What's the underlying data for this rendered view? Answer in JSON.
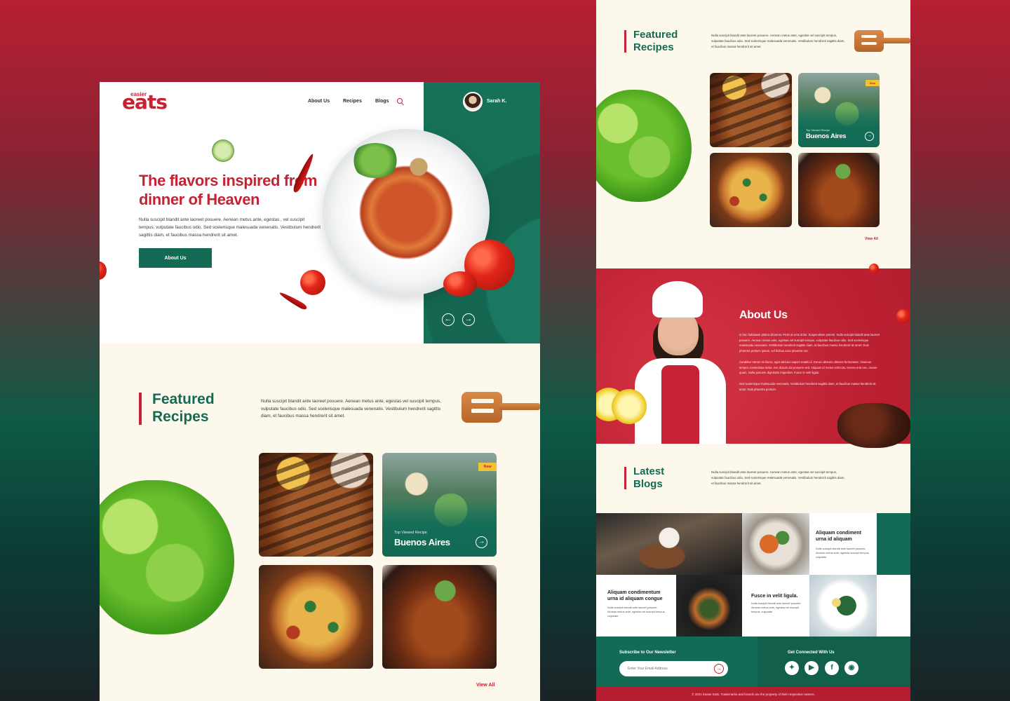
{
  "brand": {
    "logo_small": "easier",
    "logo_big": "eats"
  },
  "nav": {
    "about": "About Us",
    "recipes": "Recipes",
    "blogs": "Blogs"
  },
  "user": {
    "name": "Sarah K."
  },
  "hero": {
    "title": "The flavors inspired from dinner of Heaven",
    "text": "Nulla suscipit blandit ante laoreet posuere. Aenean metus ante, egestas , vel suscipit tempus, vulputate faucibus odio. Sed scelerisque malesuada venenatis. Vestibulum hendrerit sagittis diam, et faucibus massa hendrerit sit amet.",
    "button": "About Us"
  },
  "featured": {
    "title_line1": "Featured",
    "title_line2": "Recipes",
    "text": "Nulla suscipit blandit ante laoreet posuere. Aenean metus ante, egestas vel suscipit tempus, vulputate faucibus odio. Sed scelerisque malesuada venenatis. Vestibulum hendrerit sagittis diam, et faucibus massa hendrerit sit amet.",
    "badge": "New",
    "card_small": "Top Viewed Recipe",
    "card_big": "Buenos Aires",
    "view_all": "View All"
  },
  "about": {
    "title": "About Us",
    "p1": "In hac habitasse platea dictumst. Proin at eros dolor. Suspendisse potenti. Nulla suscipit blandit ante laoreet posuere. Aenean metus ante, egestas vel suscipit tempus, vulputate faucibus odio. Sed scelerisque malesuada venenatis. Vestibulum hendrerit sagittis diam, et faucibus massa hendrerit sit amet. Duis pharetra pretium ipsum, vel finibus urna pharetra nec.",
    "p2": "Curabitur rutrum mi libero, eget ultricies sapien mattis id. Donec ultricies ultricies fermentum. Vivamus tempor consectetur tortor, nec dictum dui posuere sed. Aliquam id metus vehicula, viverra erat nec, ornare quam. Nulla posuere dignissim imperdiet. Fusce in velit ligula.",
    "p3": "Sed scelerisque malesuada venenatis. Vestibulum hendrerit sagittis diam, et faucibus massa hendrerit sit amet. Duis pharetra pretium."
  },
  "blogs": {
    "title_line1": "Latest",
    "title_line2": "Blogs",
    "text": "Nulla suscipit blandit ante laoreet posuere. Aenean metus ante, egestas vel suscipit tempus, vulputate faucibus odio. Sed scelerisque malesuada venenatis. Vestibulum hendrerit sagittis diam, et faucibus massa hendrerit sit amet.",
    "post1_title": "Aliquam condiment urna id aliquam",
    "post1_text": "Nulla suscipit blandit ante laoreet posuere. Aenean metus ante, egestas suscipit tempus, vulputate",
    "post2_title": "Aliquam condimentum urna id aliquam congue",
    "post2_text": "Nulla suscipit blandit ante laoreet posuere. Aenean metus ante, egestas vel suscipit tempus, vulputate",
    "post3_title": "Fusce in velit ligula.",
    "post3_text": "Nulla suscipit blandit ante laoreet posuere. Aenean metus ante, egestas vel suscipit tempus, vulputate"
  },
  "newsletter": {
    "label": "Subscribe to Our Newsletter",
    "placeholder": "Enter Your Email Address",
    "social_label": "Get Connected With Us"
  },
  "footer": {
    "copyright": "© 2021 Easier Eats. Trademarks and brands are the property of their respective owners."
  },
  "icons": {
    "search": "search-icon",
    "arrow_left": "arrow-left-icon",
    "arrow_right": "arrow-right-icon",
    "twitter": "twitter-icon",
    "youtube": "youtube-icon",
    "facebook": "facebook-icon",
    "instagram": "instagram-icon"
  },
  "colors": {
    "brand_red": "#c52233",
    "brand_green": "#136b55",
    "cream": "#fdf8ec",
    "badge_yellow": "#f1c232"
  }
}
